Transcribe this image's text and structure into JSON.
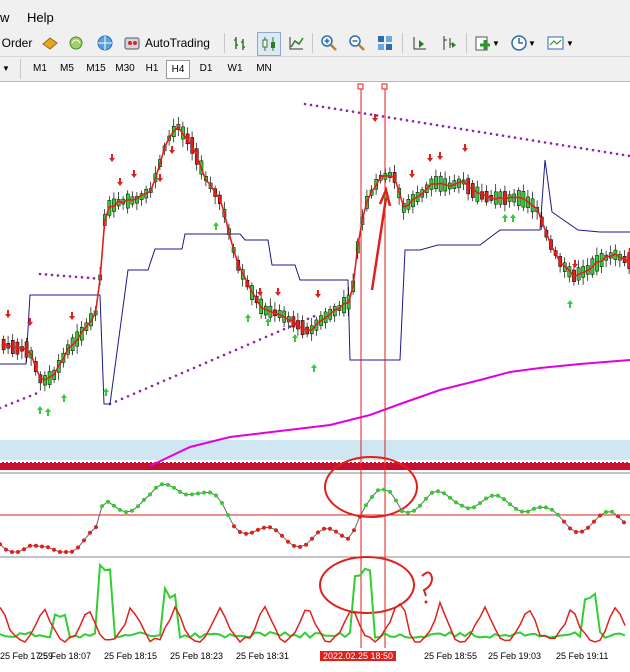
{
  "menu": {
    "view_partial": "w",
    "help": "Help"
  },
  "toolbar": {
    "order_partial": "Order",
    "autotrading": "AutoTrading"
  },
  "timeframes": [
    "M1",
    "M5",
    "M15",
    "M30",
    "H1",
    "H4",
    "D1",
    "W1",
    "MN"
  ],
  "active_timeframe": "H4",
  "time_axis": {
    "labels": [
      "25 Feb 17:59",
      "25 Feb 18:07",
      "25 Feb 18:15",
      "25 Feb 18:23",
      "25 Feb 18:31",
      "25 Feb 18:55",
      "25 Feb 19:03",
      "25 Feb 19:11"
    ],
    "highlight": "2022.02.25 18:50"
  },
  "colors": {
    "bull": "#32cd32",
    "bear": "#e0201b",
    "ma": "#ff0000",
    "channel": "#1a1a8c",
    "envelope": "#8e24aa",
    "ma_long": "#e000e0"
  }
}
